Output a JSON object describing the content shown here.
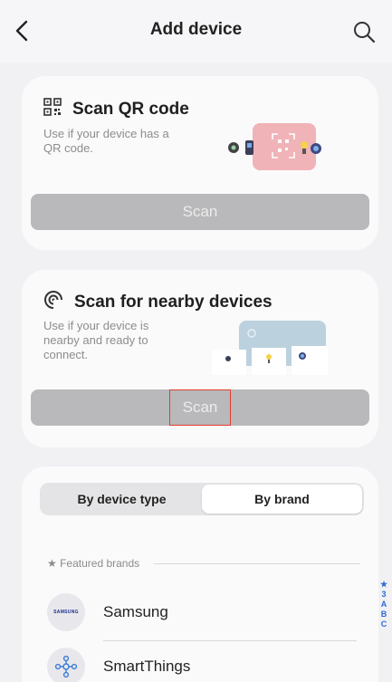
{
  "header": {
    "title": "Add device"
  },
  "qr_card": {
    "title": "Scan QR code",
    "description_line1": "Use if your device has a",
    "description_line2": "QR code.",
    "button_label": "Scan"
  },
  "nearby_card": {
    "title": "Scan for nearby devices",
    "description_line1": "Use if your device is",
    "description_line2": "nearby and ready to",
    "description_line3": "connect.",
    "button_label": "Scan"
  },
  "brand_section": {
    "tabs": [
      {
        "label": "By device type",
        "active": false
      },
      {
        "label": "By brand",
        "active": true
      }
    ],
    "featured_label": "★ Featured brands",
    "brands": [
      {
        "name": "Samsung",
        "logo_text": "SAMSUNG"
      },
      {
        "name": "SmartThings"
      }
    ],
    "index_letters": [
      "★",
      "3",
      "A",
      "B",
      "C"
    ]
  },
  "colors": {
    "accent_blue": "#2b6bd6",
    "highlight_red": "#e43c30",
    "disabled_button": "#b9b9bb"
  }
}
